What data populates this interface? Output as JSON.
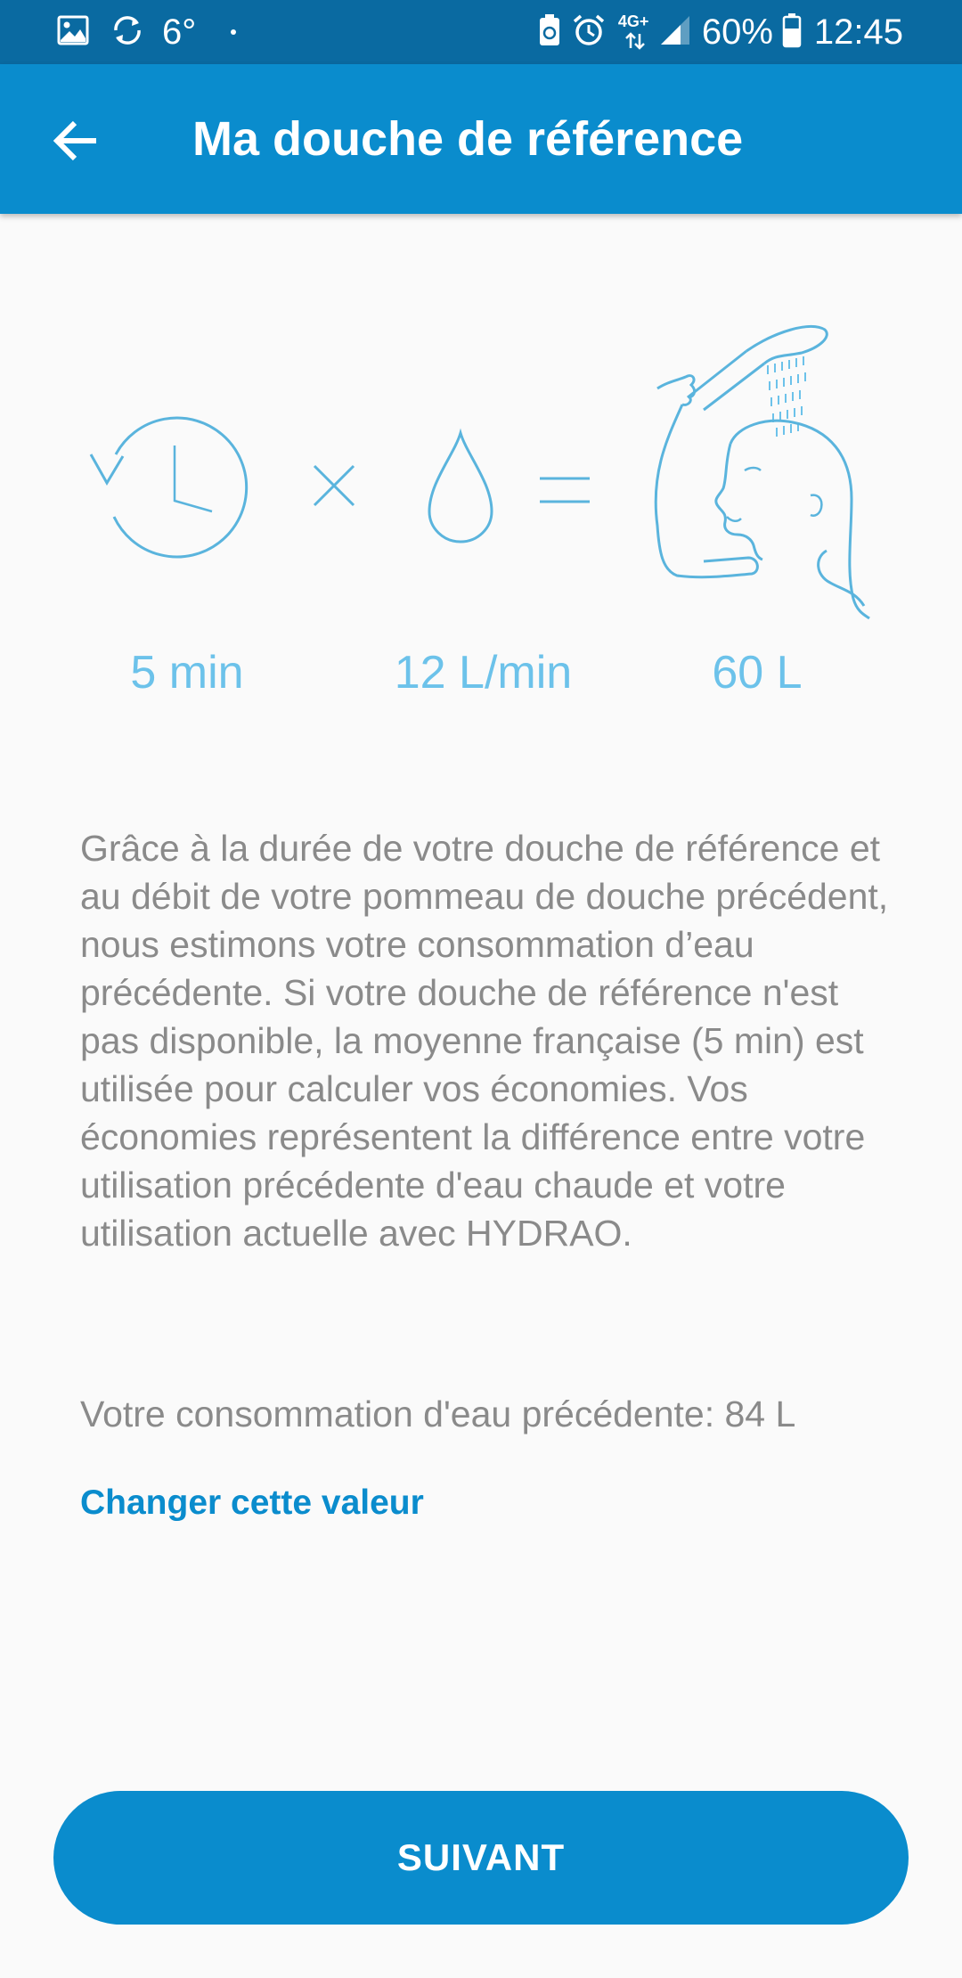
{
  "status_bar": {
    "temperature": "6°",
    "network": "4G+",
    "battery": "60%",
    "time": "12:45",
    "icons": [
      "gallery-icon",
      "sync-icon",
      "dot-icon",
      "battery-saver-icon",
      "alarm-icon",
      "data-arrows-icon",
      "signal-icon",
      "battery-icon"
    ]
  },
  "app_bar": {
    "back_icon": "arrow-left-icon",
    "title": "Ma douche de référence"
  },
  "illustration": {
    "icons": [
      "clock-history-icon",
      "multiply-icon",
      "water-drop-icon",
      "equals-icon",
      "shower-person-icon"
    ],
    "accent_color": "#5ab4dd"
  },
  "stats": {
    "duration": "5 min",
    "flow": "12 L/min",
    "total": "60 L"
  },
  "description": "Grâce à la durée de votre douche de référence et au débit de votre pommeau de douche précédent, nous estimons votre consommation d’eau précédente. Si votre douche de référence n'est pas disponible, la moyenne française (5 min) est utilisée pour calculer vos économies. Vos économies représentent la différence entre votre utilisation précédente d'eau chaude et votre utilisation actuelle avec HYDRAO.",
  "previous_consumption": "Votre consommation d'eau précédente: 84 L",
  "change_link": "Changer cette valeur",
  "next_button": "SUIVANT",
  "colors": {
    "status_bar": "#0a6aa1",
    "app_bar": "#0a8ccd",
    "primary": "#0a8ccd",
    "value_text": "#6cc2ea",
    "body_text": "#8a8a8a",
    "background": "#fafafa"
  }
}
